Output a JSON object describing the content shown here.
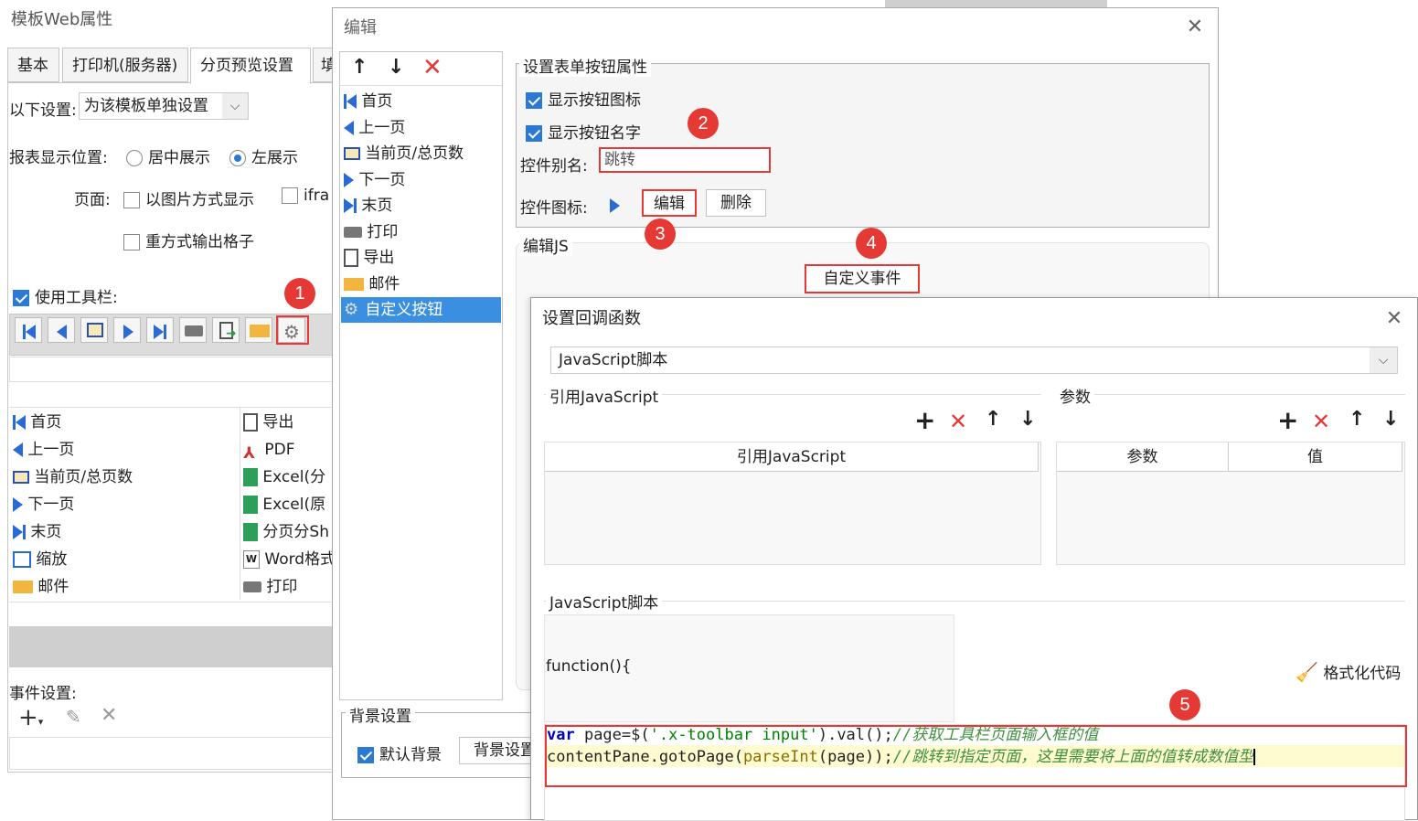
{
  "back_window": {
    "title": "模板Web属性",
    "tabs": [
      "基本",
      "打印机(服务器)",
      "分页预览设置",
      "填"
    ],
    "setting_label": "以下设置:",
    "setting_value": "为该模板单独设置",
    "position_label": "报表显示位置:",
    "position_options": [
      "居中展示",
      "左展示"
    ],
    "page_label": "页面:",
    "page_opt1": "以图片方式显示",
    "page_opt2": "ifra",
    "page_opt3": "重方式输出格子",
    "toolbar_label": "使用工具栏:",
    "list_left": [
      "首页",
      "上一页",
      "当前页/总页数",
      "下一页",
      "末页",
      "缩放",
      "邮件"
    ],
    "list_right": [
      "导出",
      "PDF",
      "Excel(分",
      "Excel(原",
      "分页分Sh",
      "Word格式",
      "打印"
    ],
    "event_label": "事件设置:"
  },
  "edit_window": {
    "title": "编辑",
    "list": [
      "首页",
      "上一页",
      "当前页/总页数",
      "下一页",
      "末页",
      "打印",
      "导出",
      "邮件",
      "自定义按钮"
    ],
    "props_title": "设置表单按钮属性",
    "show_icon": "显示按钮图标",
    "show_name": "显示按钮名字",
    "alias_label": "控件别名:",
    "alias_value": "跳转",
    "icon_label": "控件图标:",
    "edit_btn": "编辑",
    "delete_btn": "删除",
    "js_title": "编辑JS",
    "custom_event": "自定义事件",
    "bg_title": "背景设置",
    "default_bg": "默认背景",
    "bg_btn": "背景设置"
  },
  "callback_window": {
    "title": "设置回调函数",
    "script_type": "JavaScript脚本",
    "ref_title": "引用JavaScript",
    "ref_col": "引用JavaScript",
    "param_title": "参数",
    "param_col1": "参数",
    "param_col2": "值",
    "js_title": "JavaScript脚本",
    "func_head": "function(){",
    "format_btn": "格式化代码",
    "code_line1_kw": "var",
    "code_line1_a": " page=$(",
    "code_line1_str": "'.x-toolbar input'",
    "code_line1_b": ").val();",
    "code_line1_cmt": "//获取工具栏页面输入框的值",
    "code_line2_a": "contentPane.gotoPage(",
    "code_line2_fn": "parseInt",
    "code_line2_b": "(page));",
    "code_line2_cmt": "//跳转到指定页面，这里需要将上面的值转成数值型"
  },
  "badges": [
    "1",
    "2",
    "3",
    "4",
    "5"
  ],
  "colors": {
    "accent": "#2a7ad5",
    "highlight_red": "#e53935",
    "selected_row": "#3b8fe0"
  }
}
